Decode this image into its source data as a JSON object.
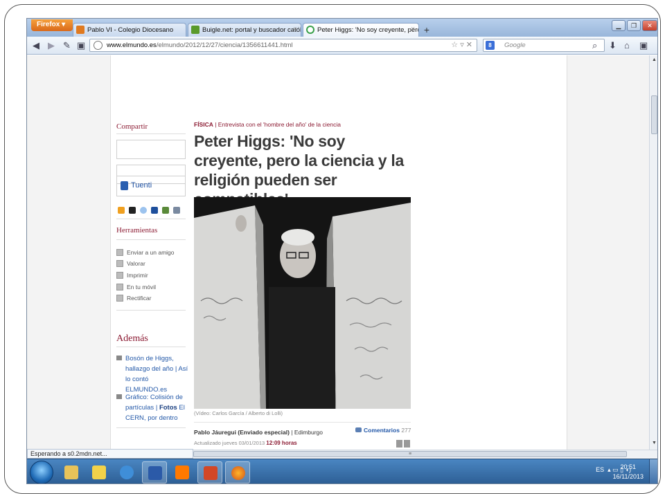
{
  "browser": {
    "menu_label": "Firefox",
    "tabs": [
      {
        "title": "Pablo VI - Colegio Diocesano",
        "favicon_color": "#e07a20"
      },
      {
        "title": "Buigle.net: portal y buscador católico",
        "favicon_color": "#5a9a2a"
      },
      {
        "title": "Peter Higgs: 'No soy creyente, pero la...",
        "favicon_color": "#3aa04a"
      }
    ],
    "url_host": "www.elmundo.es",
    "url_path": "/elmundo/2012/12/27/ciencia/1356611441.html",
    "search_placeholder": "Google",
    "status_text": "Esperando a s0.2mdn.net..."
  },
  "sidebar": {
    "share_heading": "Compartir",
    "tuenti_label": "Tuenti",
    "tools_heading": "Herramientas",
    "tools": [
      "Enviar a un amigo",
      "Valorar",
      "Imprimir",
      "En tu móvil",
      "Rectificar"
    ],
    "more_heading": "Además",
    "more_items": [
      {
        "text_a": "Bosón de Higgs, hallazgo del año | Así lo contó ELMUNDO.es",
        "bold": "",
        "text_b": ""
      },
      {
        "text_a": "Gráfico: Colisión de partículas | ",
        "bold": "Fotos",
        "text_b": " El CERN, por dentro"
      }
    ]
  },
  "article": {
    "section": "FÍSICA",
    "kicker": " | Entrevista con el 'hombre del año' de la ciencia",
    "headline": "Peter Higgs: 'No soy creyente, pero la ciencia y la religión pueden ser compatibles'",
    "caption": "(Vídeo: Carlos García / Alberto di Lolli)",
    "author": "Pablo Jáuregui (Enviado especial)",
    "location": " | Edimburgo",
    "updated_label": "Actualizado jueves 03/01/2013 ",
    "updated_time": "12:09 horas",
    "comments_label": "Comentarios",
    "comments_count": " 277"
  },
  "taskbar": {
    "lang": "ES",
    "time": "20:51",
    "date": "16/11/2013"
  },
  "colors": {
    "brand": "#8b1a32",
    "link": "#2358a8"
  }
}
